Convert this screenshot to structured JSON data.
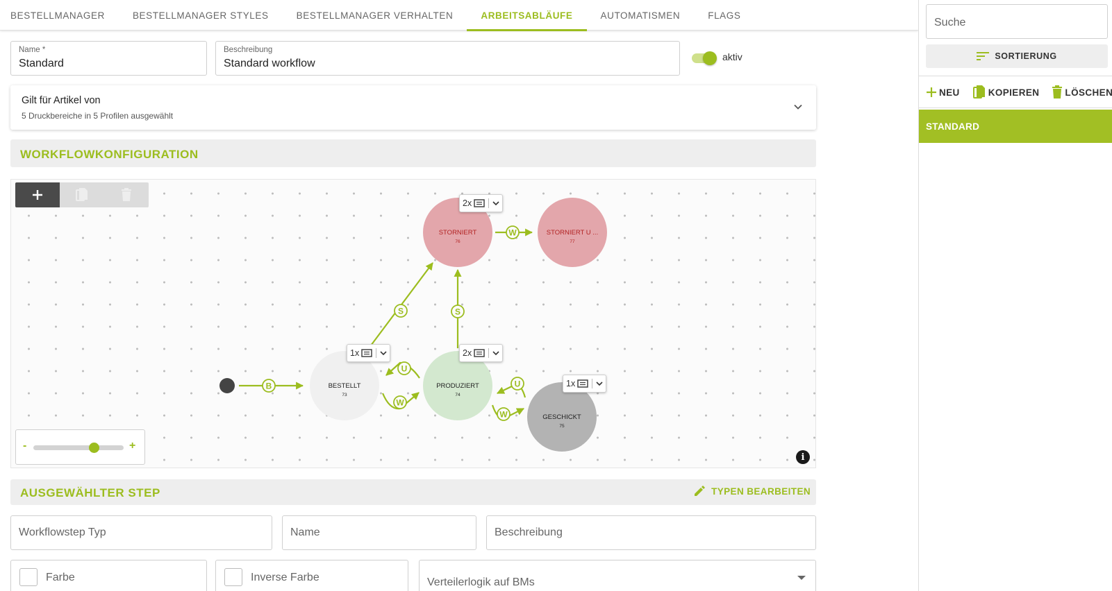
{
  "tabs": [
    {
      "label": "BESTELLMANAGER",
      "active": false
    },
    {
      "label": "BESTELLMANAGER STYLES",
      "active": false
    },
    {
      "label": "BESTELLMANAGER VERHALTEN",
      "active": false
    },
    {
      "label": "ARBEITSABLÄUFE",
      "active": true
    },
    {
      "label": "AUTOMATISMEN",
      "active": false
    },
    {
      "label": "FLAGS",
      "active": false
    }
  ],
  "form": {
    "name_label": "Name *",
    "name_value": "Standard",
    "desc_label": "Beschreibung",
    "desc_value": "Standard workflow",
    "active_label": "aktiv",
    "active": true
  },
  "applies": {
    "title": "Gilt für Artikel von",
    "subtitle": "5 Druckbereiche in 5 Profilen ausgewählt"
  },
  "workflow": {
    "section_title": "WORKFLOWKONFIGURATION",
    "nodes": [
      {
        "id": "bestellt",
        "label": "BESTELLT",
        "num": "73",
        "color": "#f0f0f0",
        "text_color": "#222222"
      },
      {
        "id": "produziert",
        "label": "PRODUZIERT",
        "num": "74",
        "color": "#d3e8cf",
        "text_color": "#222222"
      },
      {
        "id": "storniert",
        "label": "STORNIERT",
        "num": "76",
        "color": "#e3a6ab",
        "text_color": "#b22222"
      },
      {
        "id": "storniert_u",
        "label": "STORNIERT U ...",
        "num": "77",
        "color": "#e3a6ab",
        "text_color": "#b22222"
      },
      {
        "id": "geschickt",
        "label": "GESCHICKT",
        "num": "75",
        "color": "#b3b3b3",
        "text_color": "#222222"
      }
    ],
    "edge_letters": {
      "b": "B",
      "s": "S",
      "w": "W",
      "u": "U"
    },
    "chips": {
      "storniert": "2x",
      "bestellt": "1x",
      "produziert": "2x",
      "geschickt": "1x"
    },
    "zoom_minus": "-",
    "zoom_plus": "+",
    "zoom_level": 0.82,
    "info": "i",
    "accent": "#9cbd1f"
  },
  "step": {
    "section_title": "AUSGEWÄHLTER STEP",
    "edit_types": "TYPEN BEARBEITEN",
    "type_placeholder": "Workflowstep Typ",
    "name_placeholder": "Name",
    "desc_placeholder": "Beschreibung",
    "color_label": "Farbe",
    "inverse_label": "Inverse Farbe",
    "logic_placeholder": "Verteilerlogik auf BMs"
  },
  "sidebar": {
    "search_placeholder": "Suche",
    "sort_label": "SORTIERUNG",
    "new_label": "NEU",
    "copy_label": "KOPIEREN",
    "delete_label": "LÖSCHEN",
    "items": [
      {
        "label": "STANDARD",
        "selected": true
      }
    ]
  }
}
